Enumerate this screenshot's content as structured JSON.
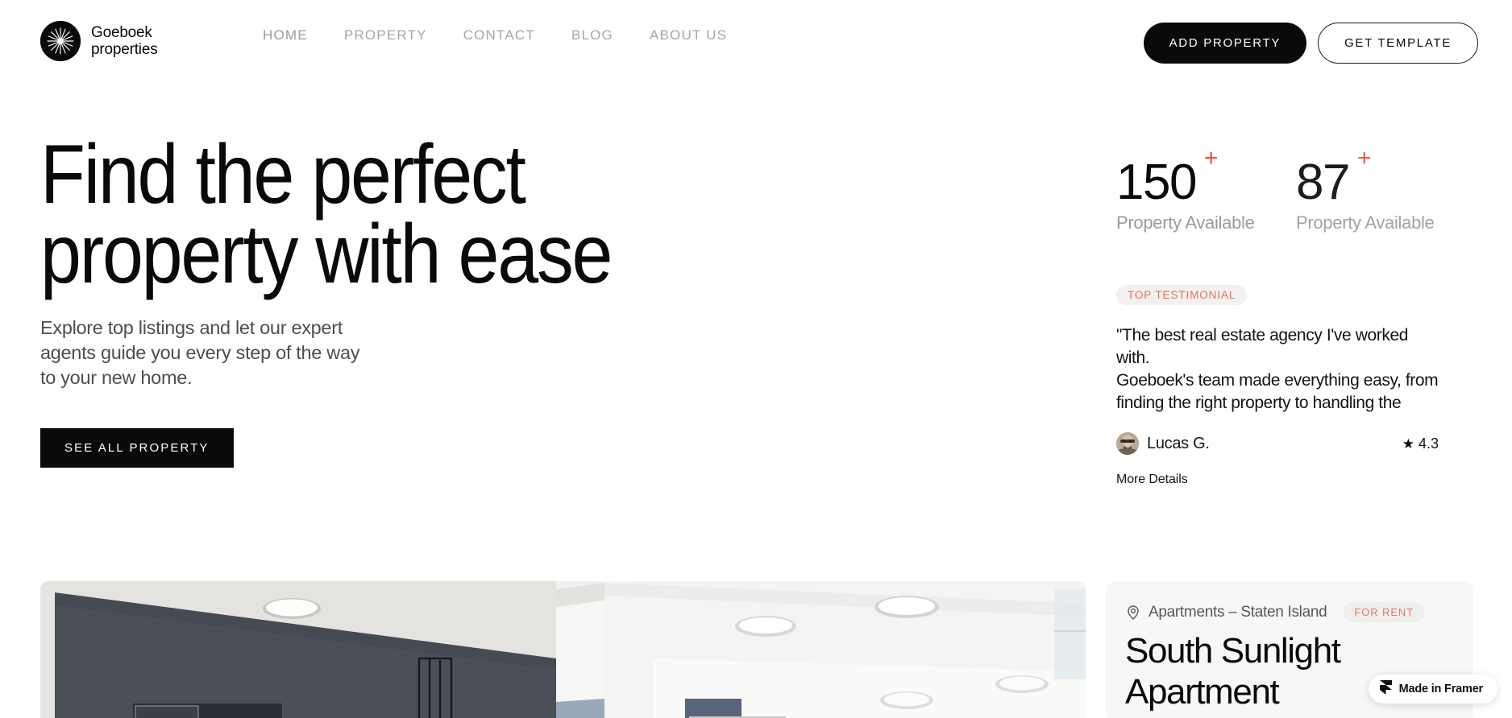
{
  "header": {
    "brand": {
      "name": "Goeboek\nproperties",
      "logo_icon": "sunburst-circle-logo"
    },
    "nav": [
      {
        "label": "HOME"
      },
      {
        "label": "PROPERTY"
      },
      {
        "label": "CONTACT"
      },
      {
        "label": "BLOG"
      },
      {
        "label": "ABOUT US"
      }
    ],
    "actions": {
      "add_property": "ADD PROPERTY",
      "get_template": "GET TEMPLATE"
    }
  },
  "hero": {
    "title": "Find the perfect\nproperty with ease",
    "subtitle": "Explore top listings and let our expert\nagents guide you every step of the way\nto your new home.",
    "cta": "SEE ALL PROPERTY"
  },
  "stats": [
    {
      "value": "150",
      "plus": "+",
      "label": "Property Available"
    },
    {
      "value": "87",
      "plus": "+",
      "label": "Property Available"
    }
  ],
  "testimonial": {
    "badge": "TOP TESTIMONIAL",
    "quote": "\"The best real estate agency I've worked with.\nGoeboek's team made everything easy, from\nfinding the right property to handling the",
    "reviewer": "Lucas G.",
    "rating": "4.3",
    "star_icon": "star-icon",
    "more_details": "More Details"
  },
  "property_card": {
    "pin_icon": "location-pin-icon",
    "location": "Apartments – Staten Island",
    "status_badge": "FOR RENT",
    "title": "South Sunlight\nApartment"
  },
  "framer_badge": {
    "label": "Made in Framer",
    "icon": "framer-logo-icon"
  },
  "photo": {
    "alt": "apartment-interior-ceiling-photo"
  },
  "colors": {
    "accent_orange": "#e8543a",
    "badge_orange": "#e8705c",
    "rent_orange": "#de7b68",
    "dark": "#0a0a0a",
    "nav_gray": "#a6a6a6",
    "body_gray": "#4a4f50",
    "stat_label_gray": "#9b9b9b",
    "card_bg": "#f7f7f6",
    "badge_bg": "#f1f1f1"
  }
}
